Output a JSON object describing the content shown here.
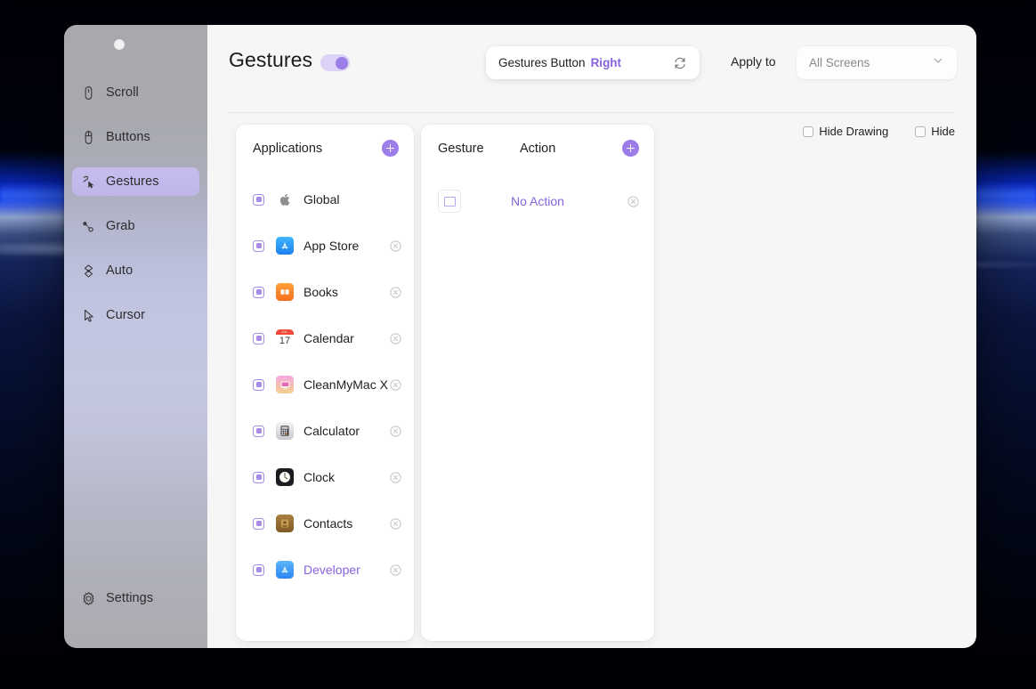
{
  "window": {
    "traffic_light": "close-dot"
  },
  "sidebar": {
    "items": [
      {
        "label": "Scroll",
        "icon": "mouse-scroll-icon",
        "selected": false
      },
      {
        "label": "Buttons",
        "icon": "mouse-buttons-icon",
        "selected": false
      },
      {
        "label": "Gestures",
        "icon": "gesture-stroke-icon",
        "selected": true
      },
      {
        "label": "Grab",
        "icon": "grab-nodes-icon",
        "selected": false
      },
      {
        "label": "Auto",
        "icon": "auto-diamond-icon",
        "selected": false
      },
      {
        "label": "Cursor",
        "icon": "cursor-arrow-icon",
        "selected": false
      }
    ],
    "settings": {
      "label": "Settings",
      "icon": "gear-icon"
    }
  },
  "header": {
    "title": "Gestures",
    "toggle": {
      "state": "on",
      "name": "gestures-enable-toggle"
    },
    "trigger_pill": {
      "label": "Gestures Button",
      "value": "Right",
      "refresh_icon": "refresh-icon"
    },
    "apply_to": {
      "label": "Apply to",
      "selected": "All Screens",
      "caret_icon": "chevron-down-icon"
    },
    "checkboxes": [
      {
        "label": "Hide Drawing",
        "checked": false
      },
      {
        "label": "Hide",
        "checked": false
      }
    ]
  },
  "applications_panel": {
    "title": "Applications",
    "add_icon": "plus-icon",
    "rows": [
      {
        "name": "Global",
        "icon": "apple-logo-icon",
        "enabled": true,
        "active": false,
        "removable": false
      },
      {
        "name": "App Store",
        "icon": "app-store-icon",
        "enabled": true,
        "active": false,
        "removable": true
      },
      {
        "name": "Books",
        "icon": "books-icon",
        "enabled": true,
        "active": false,
        "removable": true
      },
      {
        "name": "Calendar",
        "icon": "calendar-icon",
        "enabled": true,
        "active": false,
        "removable": true,
        "cal_month": "JUL",
        "cal_day": "17"
      },
      {
        "name": "CleanMyMac X",
        "icon": "cleanmymac-icon",
        "enabled": true,
        "active": false,
        "removable": true
      },
      {
        "name": "Calculator",
        "icon": "calculator-icon",
        "enabled": true,
        "active": false,
        "removable": true
      },
      {
        "name": "Clock",
        "icon": "clock-icon",
        "enabled": true,
        "active": false,
        "removable": true
      },
      {
        "name": "Contacts",
        "icon": "contacts-icon",
        "enabled": true,
        "active": false,
        "removable": true
      },
      {
        "name": "Developer",
        "icon": "developer-icon",
        "enabled": true,
        "active": true,
        "removable": true
      }
    ]
  },
  "gestures_panel": {
    "column_gesture": "Gesture",
    "column_action": "Action",
    "add_icon": "plus-icon",
    "rows": [
      {
        "gesture": "square-stroke",
        "action": "No Action",
        "removable": true
      }
    ]
  },
  "colors": {
    "accent": "#8763e0",
    "accent_soft": "#a98ce8",
    "add_button": "#9d7ee8",
    "toggle_track": "#ddd3f6",
    "toggle_knob": "#9b7ee8",
    "sidebar_selected": "#c0b6ea",
    "content_bg": "#f6f6f7",
    "panel_bg": "#ffffff",
    "text": "#1f1f21",
    "muted": "#8a8a8e"
  }
}
